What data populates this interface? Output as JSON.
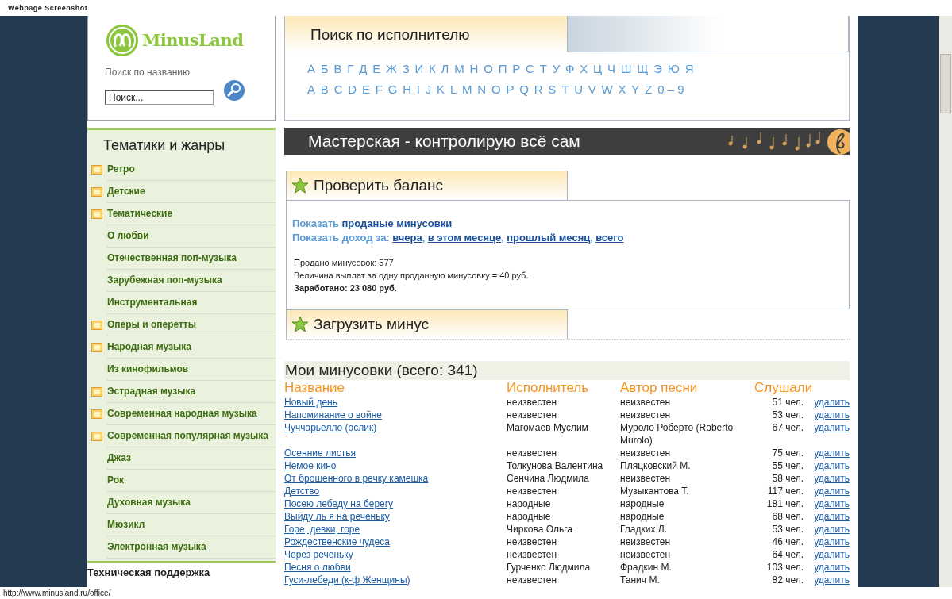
{
  "caption": "Webpage Screenshot",
  "logo": {
    "text": "MinusLand"
  },
  "title_search": {
    "label": "Поиск по названию",
    "placeholder": "Поиск..."
  },
  "artist_search": {
    "title": "Поиск по исполнителю",
    "cyrillic_letters": [
      "А",
      "Б",
      "В",
      "Г",
      "Д",
      "Е",
      "Ж",
      "З",
      "И",
      "К",
      "Л",
      "М",
      "Н",
      "О",
      "П",
      "Р",
      "С",
      "Т",
      "У",
      "Ф",
      "Х",
      "Ц",
      "Ч",
      "Ш",
      "Щ",
      "Э",
      "Ю",
      "Я"
    ],
    "latin_letters": [
      "A",
      "B",
      "C",
      "D",
      "E",
      "F",
      "G",
      "H",
      "I",
      "J",
      "K",
      "L",
      "M",
      "N",
      "O",
      "P",
      "Q",
      "R",
      "S",
      "T",
      "U",
      "V",
      "W",
      "X",
      "Y",
      "Z",
      "0 – 9"
    ]
  },
  "sidebar": {
    "title": "Тематики и жанры",
    "items": [
      {
        "label": "Ретро",
        "kind": "folder"
      },
      {
        "label": "Детские",
        "kind": "folder"
      },
      {
        "label": "Тематические",
        "kind": "folder"
      },
      {
        "label": "О любви",
        "kind": "plain"
      },
      {
        "label": "Отечественная поп-музыка",
        "kind": "plain"
      },
      {
        "label": "Зарубежная поп-музыка",
        "kind": "plain"
      },
      {
        "label": "Инструментальная",
        "kind": "plain"
      },
      {
        "label": "Оперы и оперетты",
        "kind": "folder"
      },
      {
        "label": "Народная музыка",
        "kind": "folder"
      },
      {
        "label": "Из кинофильмов",
        "kind": "plain"
      },
      {
        "label": "Эстрадная музыка",
        "kind": "folder"
      },
      {
        "label": "Современная народная музыка",
        "kind": "folder"
      },
      {
        "label": "Современная популярная музыка",
        "kind": "folder"
      },
      {
        "label": "Джаз",
        "kind": "plain"
      },
      {
        "label": "Рок",
        "kind": "plain"
      },
      {
        "label": "Духовная музыка",
        "kind": "plain"
      },
      {
        "label": "Мюзикл",
        "kind": "plain"
      },
      {
        "label": "Электронная музыка",
        "kind": "plain"
      }
    ],
    "footer": "Техническая поддержка"
  },
  "banner": {
    "title": "Мастерская - контролирую всё сам"
  },
  "balance": {
    "tab": "Проверить баланс",
    "links_lines": [
      {
        "label": "Показать",
        "links": [
          "проданые минусовки"
        ]
      },
      {
        "label": "Показать доход за:",
        "links": [
          "вчера",
          "в этом месяце",
          "прошлый месяц",
          "всего"
        ]
      }
    ],
    "separator": ",",
    "stats": [
      {
        "text": "Продано минусовок: 577",
        "bold": false
      },
      {
        "text": "Величина выплат за одну проданную минусовку = 40 руб.",
        "bold": false
      },
      {
        "text": "Заработано: 23 080 руб.",
        "bold": true
      }
    ]
  },
  "upload": {
    "tab": "Загрузить минус"
  },
  "tracks": {
    "title": "Мои минусовки (всего: 341)",
    "columns": [
      "Название",
      "Исполнитель",
      "Автор песни",
      "Слушали"
    ],
    "rows": [
      {
        "name": "Новый день",
        "performer": "неизвестен",
        "author": "неизвестен",
        "listens": "51 чел.",
        "action": "удалить"
      },
      {
        "name": "Напоминание о войне",
        "performer": "неизвестен",
        "author": "неизвестен",
        "listens": "53 чел.",
        "action": "удалить"
      },
      {
        "name": "Чуччарьелло (ослик)",
        "performer": "Магомаев Муслим",
        "author": "Муроло Роберто (Roberto Murolo)",
        "listens": "67 чел.",
        "action": "удалить"
      },
      {
        "name": "Осенние листья",
        "performer": "неизвестен",
        "author": "неизвестен",
        "listens": "75 чел.",
        "action": "удалить"
      },
      {
        "name": "Немое кино",
        "performer": "Толкунова Валентина",
        "author": "Пляцковский М.",
        "listens": "55 чел.",
        "action": "удалить"
      },
      {
        "name": "От брошенного в речку камешка",
        "performer": "Сенчина Людмила",
        "author": "неизвестен",
        "listens": "58 чел.",
        "action": "удалить"
      },
      {
        "name": "Детство",
        "performer": "неизвестен",
        "author": "Музыкантова Т.",
        "listens": "117 чел.",
        "action": "удалить"
      },
      {
        "name": "Посею лебеду на берегу",
        "performer": "народные",
        "author": "народные",
        "listens": "181 чел.",
        "action": "удалить"
      },
      {
        "name": "Выйду ль я на реченьку",
        "performer": "народные",
        "author": "народные",
        "listens": "68 чел.",
        "action": "удалить"
      },
      {
        "name": "Горе, девки, горе",
        "performer": "Чиркова Ольга",
        "author": "Гладких Л.",
        "listens": "53 чел.",
        "action": "удалить"
      },
      {
        "name": "Рождественские чудеса",
        "performer": "неизвестен",
        "author": "неизвестен",
        "listens": "46 чел.",
        "action": "удалить"
      },
      {
        "name": "Через реченьку",
        "performer": "неизвестен",
        "author": "неизвестен",
        "listens": "64 чел.",
        "action": "удалить"
      },
      {
        "name": "Песня о любви",
        "performer": "Гурченко Людмила",
        "author": "Фрадкин М.",
        "listens": "103 чел.",
        "action": "удалить"
      },
      {
        "name": "Гуси-лебеди (к-ф Женщины)",
        "performer": "неизвестен",
        "author": "Танич М.",
        "listens": "82 чел.",
        "action": "удалить"
      }
    ]
  },
  "status_bar": {
    "url": "http://www.minusland.ru/office/"
  }
}
